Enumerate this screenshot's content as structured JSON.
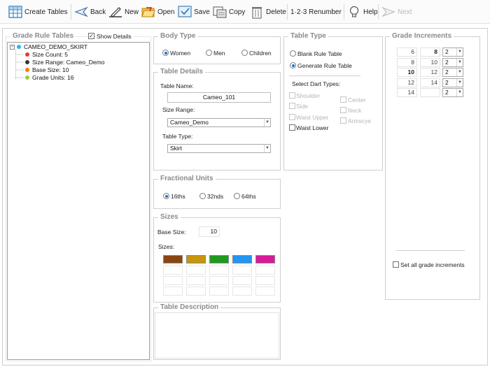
{
  "toolbar": {
    "create_tables": "Create Tables",
    "back": "Back",
    "new": "New",
    "open": "Open",
    "save": "Save",
    "copy": "Copy",
    "delete": "Delete",
    "renumber": "1·2·3 Renumber",
    "help": "Help",
    "next": "Next"
  },
  "tree_panel": {
    "title": "Grade Rule Tables",
    "show_details_label": "Show Details",
    "show_details_checked": true,
    "root": "CAMEO_DEMO_SKIRT",
    "items": [
      {
        "label": "Size Count: 5",
        "color": "#e53935"
      },
      {
        "label": "Size Range: Cameo_Demo",
        "color": "#333333"
      },
      {
        "label": "Base Size: 10",
        "color": "#f57c00"
      },
      {
        "label": "Grade Units: 16",
        "color": "#9ccc3a"
      }
    ]
  },
  "body_type": {
    "title": "Body Type",
    "options": [
      "Women",
      "Men",
      "Children"
    ],
    "selected": "Women"
  },
  "table_details": {
    "title": "Table Details",
    "table_name_label": "Table Name:",
    "table_name_value": "Cameo_101",
    "size_range_label": "Size Range:",
    "size_range_value": "Cameo_Demo",
    "table_type_label": "Table Type:",
    "table_type_value": "Skirt"
  },
  "fractional_units": {
    "title": "Fractional Units",
    "options": [
      "16ths",
      "32nds",
      "64ths"
    ],
    "selected": "16ths"
  },
  "sizes": {
    "title": "Sizes",
    "base_size_label": "Base Size:",
    "base_size_value": "10",
    "sizes_label": "Sizes:",
    "swatches": [
      {
        "color": "#8b4513",
        "label": ""
      },
      {
        "color": "#c8960c",
        "label": ""
      },
      {
        "color": "#1f9a1f",
        "label": ""
      },
      {
        "color": "#2196f3",
        "label": ""
      },
      {
        "color": "#d81b9a",
        "label": ""
      }
    ]
  },
  "table_description": {
    "title": "Table Description",
    "value": ""
  },
  "table_type": {
    "title": "Table Type",
    "options": [
      "Blank Rule Table",
      "Generate Rule Table"
    ],
    "selected": "Generate Rule Table",
    "dart_label": "Select Dart Types:",
    "darts": [
      {
        "label": "Shoulder",
        "enabled": false
      },
      {
        "label": "Center",
        "enabled": false
      },
      {
        "label": "Side",
        "enabled": false
      },
      {
        "label": "Neck",
        "enabled": false
      },
      {
        "label": "Waist Upper",
        "enabled": false
      },
      {
        "label": "Armscye",
        "enabled": false
      },
      {
        "label": "Waist Lower",
        "enabled": true
      }
    ]
  },
  "grade_increments": {
    "title": "Grade Increments",
    "rows": [
      {
        "a": "6",
        "b": "8",
        "inc": "2",
        "a_bold": false,
        "b_bold": true
      },
      {
        "a": "8",
        "b": "10",
        "inc": "2",
        "a_bold": false,
        "b_bold": false
      },
      {
        "a": "10",
        "b": "12",
        "inc": "2",
        "a_bold": true,
        "b_bold": false
      },
      {
        "a": "12",
        "b": "14",
        "inc": "2",
        "a_bold": false,
        "b_bold": false
      },
      {
        "a": "14",
        "b": "",
        "inc": "2",
        "a_bold": false,
        "b_bold": false
      }
    ],
    "set_all_label": "Set all grade increments"
  }
}
